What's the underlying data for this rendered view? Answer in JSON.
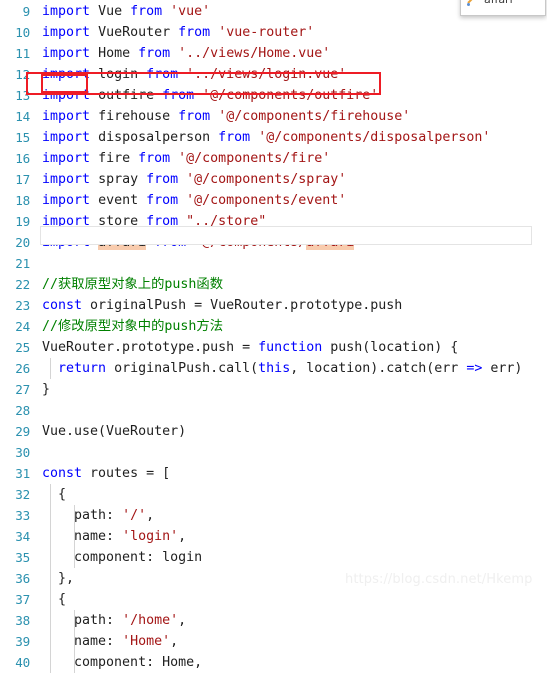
{
  "editor": {
    "language": "javascript",
    "first_visible_line": 9,
    "current_line": 21,
    "theme_colors": {
      "background": "#ffffff",
      "keyword": "#0000ff",
      "string": "#a31515",
      "comment": "#008000",
      "identifier": "#1f1f1f",
      "line_number": "#2b91af",
      "search_highlight": "#f8cbad",
      "annotation_box": "#ee1c25",
      "current_line_border": "#e4e4e4",
      "indent_guide": "#d4d4d4"
    }
  },
  "autocomplete": {
    "visible": true,
    "icon": "property-icon",
    "item_label": "affari"
  },
  "watermark": {
    "text": "https://blog.csdn.net/Hkemp"
  },
  "annotations": [
    {
      "name": "import-line-box",
      "target_line": 13,
      "shape": "rectangle",
      "color": "#ee1c25"
    },
    {
      "name": "import-keyword-box",
      "target_line": 13,
      "shape": "rectangle",
      "color": "#ee1c25"
    }
  ],
  "lines": [
    {
      "num": 9,
      "indent": 0,
      "tokens": [
        {
          "t": "import",
          "c": "kw"
        },
        {
          "t": " ",
          "c": "pun"
        },
        {
          "t": "Vue",
          "c": "id"
        },
        {
          "t": " ",
          "c": "pun"
        },
        {
          "t": "from",
          "c": "kw"
        },
        {
          "t": " ",
          "c": "pun"
        },
        {
          "t": "'vue'",
          "c": "str"
        }
      ]
    },
    {
      "num": 10,
      "indent": 0,
      "tokens": [
        {
          "t": "import",
          "c": "kw"
        },
        {
          "t": " ",
          "c": "pun"
        },
        {
          "t": "VueRouter",
          "c": "id"
        },
        {
          "t": " ",
          "c": "pun"
        },
        {
          "t": "from",
          "c": "kw"
        },
        {
          "t": " ",
          "c": "pun"
        },
        {
          "t": "'vue-router'",
          "c": "str"
        }
      ]
    },
    {
      "num": 11,
      "indent": 0,
      "tokens": [
        {
          "t": "import",
          "c": "kw"
        },
        {
          "t": " ",
          "c": "pun"
        },
        {
          "t": "Home",
          "c": "id"
        },
        {
          "t": " ",
          "c": "pun"
        },
        {
          "t": "from",
          "c": "kw"
        },
        {
          "t": " ",
          "c": "pun"
        },
        {
          "t": "'../views/Home.vue'",
          "c": "str"
        }
      ]
    },
    {
      "num": 12,
      "indent": 0,
      "tokens": [
        {
          "t": "import",
          "c": "kw"
        },
        {
          "t": " ",
          "c": "pun"
        },
        {
          "t": "login",
          "c": "id"
        },
        {
          "t": " ",
          "c": "pun"
        },
        {
          "t": "from",
          "c": "kw"
        },
        {
          "t": " ",
          "c": "pun"
        },
        {
          "t": "'../views/login.vue'",
          "c": "str"
        }
      ]
    },
    {
      "num": 13,
      "indent": 0,
      "tokens": [
        {
          "t": "import",
          "c": "kw"
        },
        {
          "t": " ",
          "c": "pun"
        },
        {
          "t": "outfire",
          "c": "id"
        },
        {
          "t": " ",
          "c": "pun"
        },
        {
          "t": "from",
          "c": "kw"
        },
        {
          "t": " ",
          "c": "pun"
        },
        {
          "t": "'@/components/outfire'",
          "c": "str"
        }
      ]
    },
    {
      "num": 14,
      "indent": 0,
      "tokens": [
        {
          "t": "import",
          "c": "kw"
        },
        {
          "t": " ",
          "c": "pun"
        },
        {
          "t": "firehouse",
          "c": "id"
        },
        {
          "t": " ",
          "c": "pun"
        },
        {
          "t": "from",
          "c": "kw"
        },
        {
          "t": " ",
          "c": "pun"
        },
        {
          "t": "'@/components/firehouse'",
          "c": "str"
        }
      ]
    },
    {
      "num": 15,
      "indent": 0,
      "tokens": [
        {
          "t": "import",
          "c": "kw"
        },
        {
          "t": " ",
          "c": "pun"
        },
        {
          "t": "disposalperson",
          "c": "id"
        },
        {
          "t": " ",
          "c": "pun"
        },
        {
          "t": "from",
          "c": "kw"
        },
        {
          "t": " ",
          "c": "pun"
        },
        {
          "t": "'@/components/disposalperson'",
          "c": "str"
        }
      ]
    },
    {
      "num": 16,
      "indent": 0,
      "tokens": [
        {
          "t": "import",
          "c": "kw"
        },
        {
          "t": " ",
          "c": "pun"
        },
        {
          "t": "fire",
          "c": "id"
        },
        {
          "t": " ",
          "c": "pun"
        },
        {
          "t": "from",
          "c": "kw"
        },
        {
          "t": " ",
          "c": "pun"
        },
        {
          "t": "'@/components/fire'",
          "c": "str"
        }
      ]
    },
    {
      "num": 17,
      "indent": 0,
      "tokens": [
        {
          "t": "import",
          "c": "kw"
        },
        {
          "t": " ",
          "c": "pun"
        },
        {
          "t": "spray",
          "c": "id"
        },
        {
          "t": " ",
          "c": "pun"
        },
        {
          "t": "from",
          "c": "kw"
        },
        {
          "t": " ",
          "c": "pun"
        },
        {
          "t": "'@/components/spray'",
          "c": "str"
        }
      ]
    },
    {
      "num": 18,
      "indent": 0,
      "tokens": [
        {
          "t": "import",
          "c": "kw"
        },
        {
          "t": " ",
          "c": "pun"
        },
        {
          "t": "event",
          "c": "id"
        },
        {
          "t": " ",
          "c": "pun"
        },
        {
          "t": "from",
          "c": "kw"
        },
        {
          "t": " ",
          "c": "pun"
        },
        {
          "t": "'@/components/event'",
          "c": "str"
        }
      ]
    },
    {
      "num": 19,
      "indent": 0,
      "tokens": [
        {
          "t": "import",
          "c": "kw"
        },
        {
          "t": " ",
          "c": "pun"
        },
        {
          "t": "store",
          "c": "id"
        },
        {
          "t": " ",
          "c": "pun"
        },
        {
          "t": "from",
          "c": "kw"
        },
        {
          "t": " ",
          "c": "pun"
        },
        {
          "t": "\"../store\"",
          "c": "str"
        }
      ]
    },
    {
      "num": 20,
      "indent": 0,
      "tokens": [
        {
          "t": "import",
          "c": "kw"
        },
        {
          "t": " ",
          "c": "pun"
        },
        {
          "t": "affari",
          "c": "id hl"
        },
        {
          "t": " ",
          "c": "pun"
        },
        {
          "t": "from",
          "c": "kw"
        },
        {
          "t": " ",
          "c": "pun"
        },
        {
          "t": "'@/components/",
          "c": "str"
        },
        {
          "t": "affari",
          "c": "str hl"
        },
        {
          "t": "'",
          "c": "str"
        }
      ]
    },
    {
      "num": 21,
      "indent": 0,
      "tokens": []
    },
    {
      "num": 22,
      "indent": 0,
      "tokens": [
        {
          "t": "//",
          "c": "com"
        },
        {
          "t": "获取原型对象上的",
          "c": "com cjk"
        },
        {
          "t": "push",
          "c": "com"
        },
        {
          "t": "函数",
          "c": "com cjk"
        }
      ]
    },
    {
      "num": 23,
      "indent": 0,
      "tokens": [
        {
          "t": "const",
          "c": "kw"
        },
        {
          "t": " ",
          "c": "pun"
        },
        {
          "t": "originalPush = VueRouter.prototype.push",
          "c": "id"
        }
      ]
    },
    {
      "num": 24,
      "indent": 0,
      "tokens": [
        {
          "t": "//",
          "c": "com"
        },
        {
          "t": "修改原型对象中的",
          "c": "com cjk"
        },
        {
          "t": "push",
          "c": "com"
        },
        {
          "t": "方法",
          "c": "com cjk"
        }
      ]
    },
    {
      "num": 25,
      "indent": 0,
      "tokens": [
        {
          "t": "VueRouter.prototype.push = ",
          "c": "id"
        },
        {
          "t": "function",
          "c": "kw"
        },
        {
          "t": " push(location) {",
          "c": "id"
        }
      ]
    },
    {
      "num": 26,
      "indent": 1,
      "tokens": [
        {
          "t": "  ",
          "c": "pun"
        },
        {
          "t": "return",
          "c": "kw"
        },
        {
          "t": " originalPush.call(",
          "c": "id"
        },
        {
          "t": "this",
          "c": "kw"
        },
        {
          "t": ", location).catch(err ",
          "c": "id"
        },
        {
          "t": "=>",
          "c": "kw"
        },
        {
          "t": " err)",
          "c": "id"
        }
      ]
    },
    {
      "num": 27,
      "indent": 0,
      "tokens": [
        {
          "t": "}",
          "c": "id"
        }
      ]
    },
    {
      "num": 28,
      "indent": 0,
      "tokens": []
    },
    {
      "num": 29,
      "indent": 0,
      "tokens": [
        {
          "t": "Vue.use(VueRouter)",
          "c": "id"
        }
      ]
    },
    {
      "num": 30,
      "indent": 0,
      "tokens": []
    },
    {
      "num": 31,
      "indent": 0,
      "tokens": [
        {
          "t": "const",
          "c": "kw"
        },
        {
          "t": " routes = [",
          "c": "id"
        }
      ]
    },
    {
      "num": 32,
      "indent": 1,
      "tokens": [
        {
          "t": "  {",
          "c": "id"
        }
      ]
    },
    {
      "num": 33,
      "indent": 2,
      "tokens": [
        {
          "t": "    path: ",
          "c": "id"
        },
        {
          "t": "'/'",
          "c": "str"
        },
        {
          "t": ",",
          "c": "id"
        }
      ]
    },
    {
      "num": 34,
      "indent": 2,
      "tokens": [
        {
          "t": "    name: ",
          "c": "id"
        },
        {
          "t": "'login'",
          "c": "str"
        },
        {
          "t": ",",
          "c": "id"
        }
      ]
    },
    {
      "num": 35,
      "indent": 2,
      "tokens": [
        {
          "t": "    component: login",
          "c": "id"
        }
      ]
    },
    {
      "num": 36,
      "indent": 1,
      "tokens": [
        {
          "t": "  },",
          "c": "id"
        }
      ]
    },
    {
      "num": 37,
      "indent": 1,
      "tokens": [
        {
          "t": "  {",
          "c": "id"
        }
      ]
    },
    {
      "num": 38,
      "indent": 2,
      "tokens": [
        {
          "t": "    path: ",
          "c": "id"
        },
        {
          "t": "'/home'",
          "c": "str"
        },
        {
          "t": ",",
          "c": "id"
        }
      ]
    },
    {
      "num": 39,
      "indent": 2,
      "tokens": [
        {
          "t": "    name: ",
          "c": "id"
        },
        {
          "t": "'Home'",
          "c": "str"
        },
        {
          "t": ",",
          "c": "id"
        }
      ]
    },
    {
      "num": 40,
      "indent": 2,
      "tokens": [
        {
          "t": "    component: Home,",
          "c": "id"
        }
      ]
    }
  ]
}
